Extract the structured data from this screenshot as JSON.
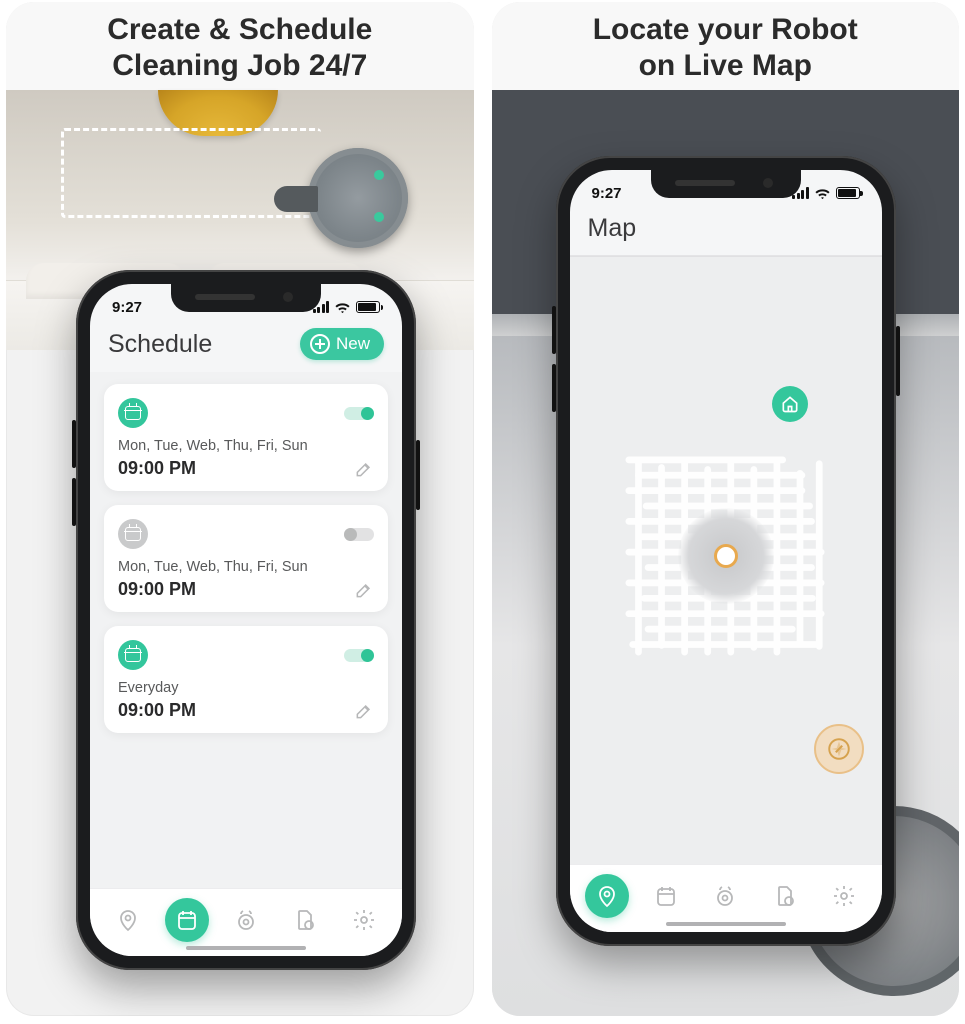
{
  "left": {
    "title_l1": "Create & Schedule",
    "title_l2": "Cleaning Job 24/7",
    "status_time": "9:27",
    "screen_title": "Schedule",
    "new_button": "New",
    "cards": [
      {
        "days": "Mon, Tue, Web, Thu, Fri, Sun",
        "time": "09:00 PM",
        "active": true
      },
      {
        "days": "Mon, Tue, Web, Thu, Fri, Sun",
        "time": "09:00 PM",
        "active": false
      },
      {
        "days": "Everyday",
        "time": "09:00 PM",
        "active": true
      }
    ],
    "nav_active_index": 1
  },
  "right": {
    "title_l1": "Locate your Robot",
    "title_l2": "on Live Map",
    "status_time": "9:27",
    "screen_title": "Map",
    "nav_active_index": 0
  },
  "colors": {
    "accent": "#34c79c",
    "muted": "#b7b8b9"
  }
}
